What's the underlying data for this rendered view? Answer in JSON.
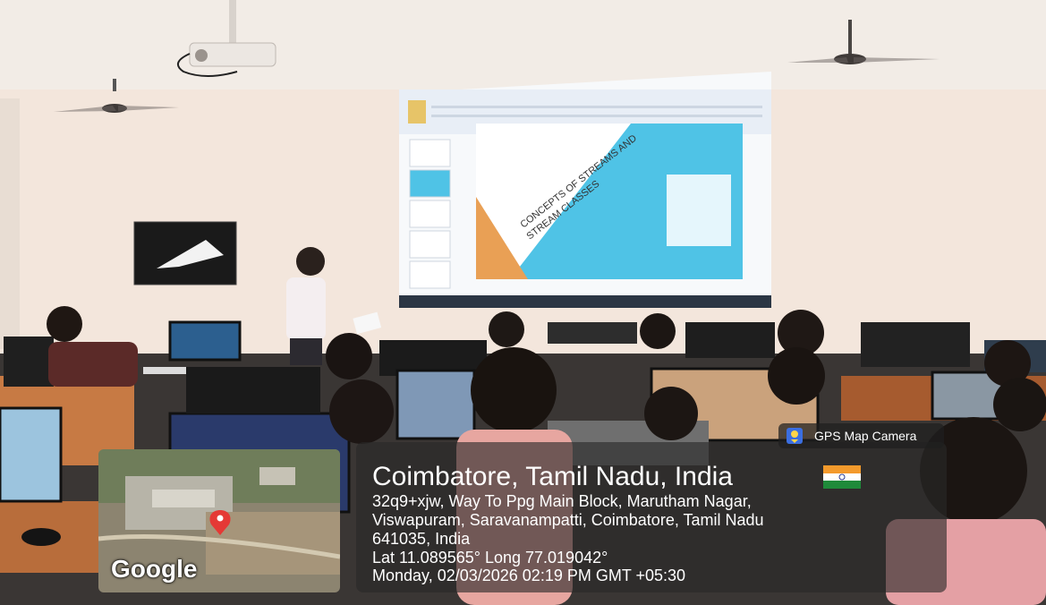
{
  "slide": {
    "title_line1": "CONCEPTS OF STREAMS AND",
    "title_line2": "STREAM CLASSES"
  },
  "overlay": {
    "badge_label": "GPS Map Camera",
    "location_title": "Coimbatore, Tamil Nadu, India",
    "address_line1": "32q9+xjw, Way To Ppg Main Block, Marutham Nagar,",
    "address_line2": "Viswapuram, Saravanampatti, Coimbatore, Tamil Nadu",
    "address_line3": "641035, India",
    "coordinates": "Lat 11.089565° Long 77.019042°",
    "datetime": "Monday, 02/03/2026 02:19 PM GMT +05:30",
    "map_logo": "Google",
    "flag_icon": "india-flag-icon"
  },
  "colors": {
    "wall": "#f3e6dc",
    "slide_blue": "#4fc3e6",
    "slide_orange": "#e9a055",
    "overlay_bg": "#2b2b2b"
  }
}
